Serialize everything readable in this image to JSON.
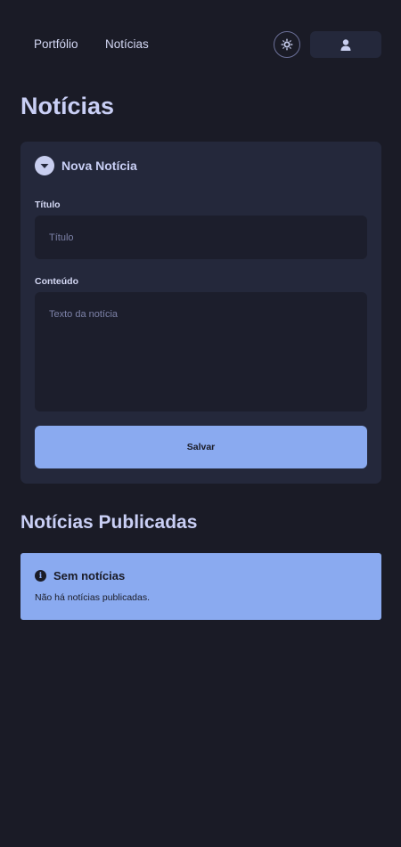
{
  "nav": {
    "links": [
      "Portfólio",
      "Notícias"
    ]
  },
  "icons": {
    "theme": "sun-icon",
    "user": "user-icon",
    "form_toggle": "chevron-down-icon",
    "alert": "info-icon"
  },
  "page": {
    "title": "Notícias"
  },
  "form": {
    "header": "Nova Notícia",
    "title_label": "Título",
    "title_placeholder": "Título",
    "title_value": "",
    "content_label": "Conteúdo",
    "content_placeholder": "Texto da notícia",
    "content_value": "",
    "save_label": "Salvar"
  },
  "published": {
    "title": "Notícias Publicadas",
    "alert_title": "Sem notícias",
    "alert_body": "Não há notícias publicadas."
  },
  "colors": {
    "background": "#1a1b26",
    "card": "#24283b",
    "accent": "#8aaaf0",
    "text": "#c9cff5"
  }
}
